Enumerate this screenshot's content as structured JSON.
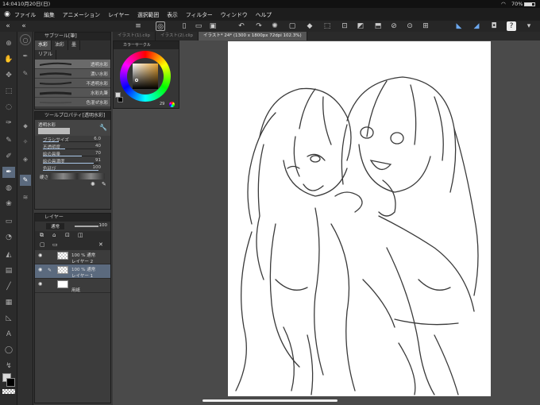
{
  "status": {
    "time": "14:04",
    "date": "10月20日(日)",
    "battery": "70%"
  },
  "menu": [
    "ファイル",
    "編集",
    "アニメーション",
    "レイヤー",
    "選択範囲",
    "表示",
    "フィルター",
    "ウィンドウ",
    "ヘルプ"
  ],
  "subtool_panel": {
    "title": "サブツール[筆]",
    "tabs": [
      "水彩",
      "油彩",
      "墨",
      "リアル"
    ],
    "brushes": [
      "透明水彩",
      "濃い水彩",
      "不透明水彩",
      "水彩丸筆",
      "色混ぜ水彩"
    ]
  },
  "tool_property": {
    "title": "ツールプロパティ[透明水彩]",
    "brush_name": "透明水彩",
    "rows": [
      {
        "label": "ブラシサイズ",
        "value": "6.0"
      },
      {
        "label": "不透明度",
        "value": "40"
      },
      {
        "label": "絵の具量",
        "value": "70"
      },
      {
        "label": "絵の具濃度",
        "value": "91"
      },
      {
        "label": "色延び",
        "value": "100"
      }
    ],
    "blend_label": "硬さ"
  },
  "layer_panel": {
    "title": "レイヤー",
    "blend_mode": "通常",
    "opacity": "100",
    "layers": [
      {
        "line1": "100 % 通常",
        "line2": "レイヤー 2"
      },
      {
        "line1": "100 % 通常",
        "line2": "レイヤー 1"
      },
      {
        "line1": "",
        "line2": "用紙"
      }
    ]
  },
  "color_panel": {
    "title": "カラーサークル",
    "value": "29"
  },
  "doc_tabs": [
    {
      "label": "イラスト(1).clip"
    },
    {
      "label": "イラスト(2).clip"
    },
    {
      "label": "イラスト* 24* (1300 x 1800px 72dpi 102.3%)"
    }
  ],
  "colors": {
    "accent": "#5b6a7e",
    "main_color": "#d8d8d8",
    "sub_color": "#000000"
  }
}
